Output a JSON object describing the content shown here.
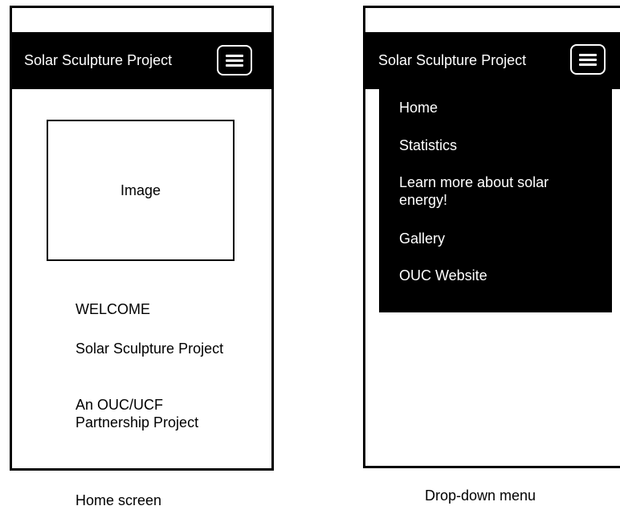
{
  "app": {
    "title": "Solar Sculpture Project",
    "menu_icon": "hamburger-menu-icon"
  },
  "home": {
    "image_placeholder": "Image",
    "welcome": "WELCOME",
    "project_title": "Solar Sculpture Project",
    "partnership": "An OUC/UCF Partnership Project"
  },
  "dropdown": {
    "items": [
      {
        "label": "Home"
      },
      {
        "label": "Statistics"
      },
      {
        "label": "Learn more about solar energy!"
      },
      {
        "label": "Gallery"
      },
      {
        "label": "OUC Website"
      }
    ]
  },
  "captions": {
    "home_screen": "Home screen",
    "dropdown_menu": "Drop-down menu"
  },
  "colors": {
    "appbar_bg": "#000000",
    "appbar_text": "#ffffff",
    "page_bg": "#ffffff"
  }
}
